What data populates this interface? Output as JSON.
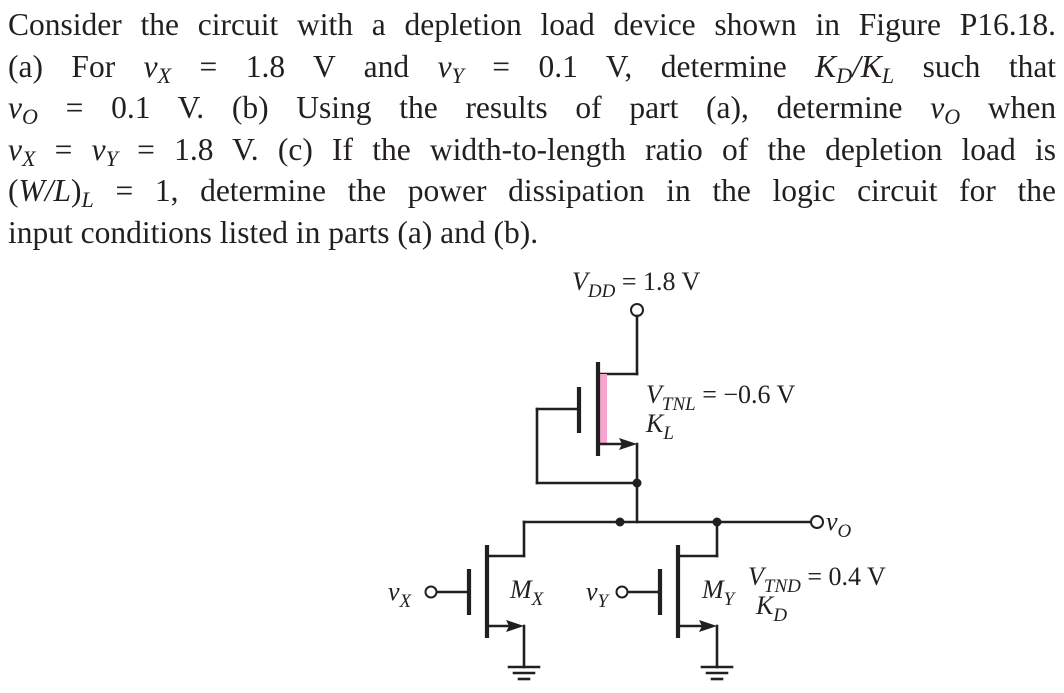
{
  "problem": {
    "figure_ref": "Figure P16.18.",
    "lines": [
      [
        "Consider the circuit with a depletion load device shown in Figure P16.18."
      ],
      [
        "(a)",
        "For",
        "v_X = 1.8 V",
        "and",
        "v_Y = 0.1 V,",
        "determine",
        "K_D/K_L",
        "such",
        "that"
      ],
      [
        "v_O = 0.1 V.",
        "(b)",
        "Using",
        "the",
        "results",
        "of",
        "part",
        "(a),",
        "determine",
        "v_O",
        "when"
      ],
      [
        "v_X = v_Y = 1.8 V. (c) If the width-to-length ratio of the depletion load is"
      ],
      [
        "(W/L)_L = 1, determine the power dissipation in the logic circuit for the"
      ],
      [
        "input conditions listed in parts (a) and (b)."
      ]
    ],
    "text": {
      "l1": "Consider the circuit with a depletion load device shown in Figure P16.18.",
      "l2_a": "(a)",
      "l2_for": "For",
      "l2_vx_eq": " = 1.8 V",
      "l2_and": "and",
      "l2_vy_eq": " = 0.1 V,",
      "l2_determine": "determine",
      "l2_such": "such",
      "l2_that": "that",
      "l3_vo_eq": " = 0.1 V.",
      "l3_b": "(b)",
      "l3_using": "Using",
      "l3_the": "the",
      "l3_results": "results",
      "l3_of": "of",
      "l3_part": "part",
      "l3_a": "(a),",
      "l3_determine": "determine",
      "l3_when": "when",
      "l4_eq": " = ",
      "l4_rest": " = 1.8 V. (c) If the width-to-length ratio of the depletion load is",
      "l5_rest": " = 1, determine the power dissipation in the logic circuit for the",
      "l6": "input conditions listed in parts (a) and (b).",
      "v": "v",
      "K": "K",
      "W": "W",
      "L": "L",
      "slash": "/",
      "lp": "(",
      "rp": ")",
      "sub_X": "X",
      "sub_Y": "Y",
      "sub_O": "O",
      "sub_D": "D",
      "sub_L": "L"
    }
  },
  "circuit": {
    "vdd": {
      "symbol": "V",
      "sub": "DD",
      "value": " = 1.8 V"
    },
    "load": {
      "vt_symbol": "V",
      "vt_sub": "TNL",
      "vt_value": " = −0.6 V",
      "k_symbol": "K",
      "k_sub": "L",
      "highlight_color": "#f4a6cf"
    },
    "driver": {
      "vt_symbol": "V",
      "vt_sub": "TND",
      "vt_value": " = 0.4 V",
      "k_symbol": "K",
      "k_sub": "D"
    },
    "mx": {
      "symbol": "M",
      "sub": "X"
    },
    "my": {
      "symbol": "M",
      "sub": "Y"
    },
    "input_x": {
      "symbol": "v",
      "sub": "X"
    },
    "input_y": {
      "symbol": "v",
      "sub": "Y"
    },
    "output": {
      "symbol": "v",
      "sub": "O"
    }
  }
}
